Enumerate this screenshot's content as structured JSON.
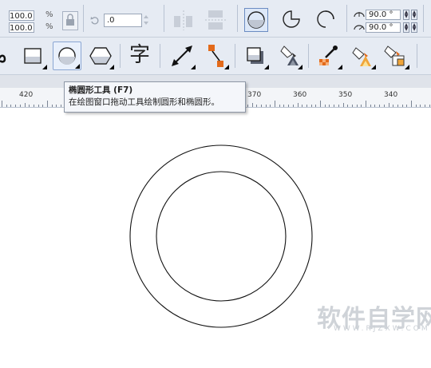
{
  "property_bar": {
    "scale_width": "100.0",
    "scale_height": "100.0",
    "percent_sign": "%",
    "rotation_value": ".0",
    "start_angle": "90.0 °",
    "end_angle": "90.0 °"
  },
  "toolbox": {
    "text_tool_glyph": "字"
  },
  "tooltip": {
    "title": "椭圆形工具 (F7)",
    "description": "在绘图窗口拖动工具绘制圆形和椭圆形。"
  },
  "ruler": {
    "labels": [
      "420",
      "370",
      "360",
      "350",
      "340"
    ]
  },
  "watermark": {
    "main": "软件自学网",
    "sub": "WWW.RJZXW.COM"
  },
  "colors": {
    "toolbar_bg": "#e6ebf3",
    "selection_border": "#8aa6d3",
    "canvas_bg": "#ffffff"
  }
}
